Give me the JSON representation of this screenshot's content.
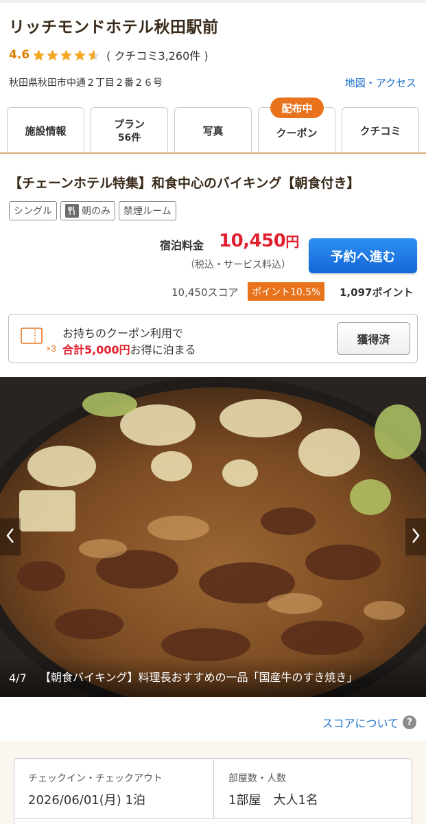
{
  "hotel": {
    "name": "リッチモンドホテル秋田駅前",
    "rating": 4.6,
    "rating_text": "4.6",
    "review_text": "( クチコミ3,260件 )",
    "address": "秋田県秋田市中通２丁目２番２６号",
    "map_link": "地図・アクセス"
  },
  "tabs": [
    {
      "label": "施設情報",
      "sub": ""
    },
    {
      "label": "プラン",
      "sub": "56件"
    },
    {
      "label": "写真",
      "sub": ""
    },
    {
      "label": "クーポン",
      "sub": ""
    },
    {
      "label": "クチコミ",
      "sub": ""
    }
  ],
  "coupon_tab_badge": "配布中",
  "plan": {
    "title": "【チェーンホテル特集】和食中心のバイキング【朝食付き】",
    "tags": [
      "シングル",
      "朝のみ",
      "禁煙ルーム"
    ],
    "price_label": "宿泊料金",
    "price": "10,450",
    "price_unit": "円",
    "price_note": "（税込・サービス料込）",
    "reserve_button": "予約へ進む",
    "score_text": "10,450スコア",
    "point_badge": "ポイント10.5%",
    "point_text": "1,097ポイント"
  },
  "coupon": {
    "icon_count": "×3",
    "line1": "お持ちのクーポン利用で",
    "line2_highlight": "合計5,000円",
    "line2_rest": "お得に泊まる",
    "button": "獲得済"
  },
  "photo": {
    "counter": "4/7",
    "caption": "【朝食バイキング】料理長おすすめの一品「国産牛のすき焼き」"
  },
  "score_link": "スコアについて",
  "help_icon": "?",
  "search": {
    "checkin_label": "チェックイン・チェックアウト",
    "checkin_value": "2026/06/01(月) 1泊",
    "rooms_label": "部屋数・人数",
    "rooms_value": "1部屋　大人1名"
  },
  "colors": {
    "accent_orange": "#e9731d",
    "price_red": "#e0202e",
    "link_blue": "#1a6fc9",
    "star": "#f5a623"
  }
}
